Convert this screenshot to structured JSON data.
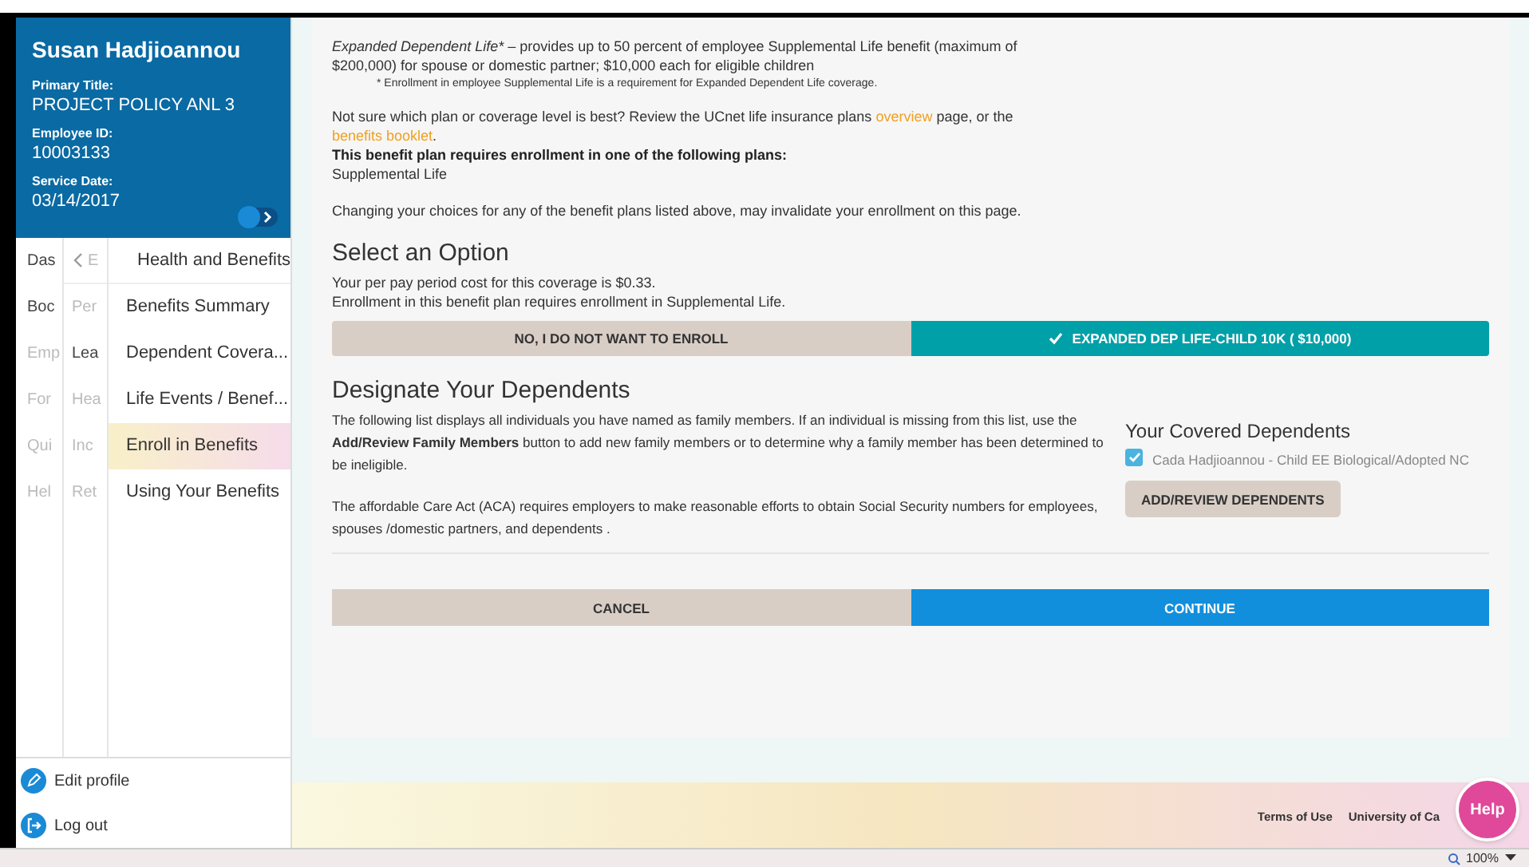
{
  "profile": {
    "name": "Susan Hadjioannou",
    "fields": [
      {
        "label": "Primary Title:",
        "value": "PROJECT POLICY ANL 3"
      },
      {
        "label": "Employee ID:",
        "value": "10003133"
      },
      {
        "label": "Service Date:",
        "value": "03/14/2017"
      }
    ]
  },
  "nav": {
    "column_1": [
      {
        "label": "Das",
        "dimmed": false
      },
      {
        "label": "Boc",
        "dimmed": false
      },
      {
        "label": "Emp",
        "dimmed": true
      },
      {
        "label": "For",
        "dimmed": true
      },
      {
        "label": "Qui",
        "dimmed": true
      },
      {
        "label": "Hel",
        "dimmed": true
      }
    ],
    "column_2": {
      "header": "E",
      "items": [
        {
          "label": "Per",
          "dimmed": true
        },
        {
          "label": "Lea",
          "dimmed": false
        },
        {
          "label": "Hea",
          "dimmed": true
        },
        {
          "label": "Inc",
          "dimmed": true
        },
        {
          "label": "Ret",
          "dimmed": true
        }
      ]
    },
    "column_3": {
      "header": "Health and Benefits",
      "items": [
        {
          "label": "Benefits Summary",
          "selected": false
        },
        {
          "label": "Dependent Covera...",
          "selected": false
        },
        {
          "label": "Life Events / Benef...",
          "selected": false
        },
        {
          "label": "Enroll in Benefits",
          "selected": true
        },
        {
          "label": "Using Your Benefits",
          "selected": false
        }
      ]
    }
  },
  "bottom_links": [
    {
      "label": "Edit profile",
      "kind": "edit"
    },
    {
      "label": "Log out",
      "kind": "logout"
    }
  ],
  "intro": {
    "term": "Expanded Dependent Life*",
    "text": "– provides up to 50 percent of employee Supplemental Life benefit (maximum of $200,000) for spouse or domestic partner; $10,000 each for eligible children",
    "footnote": "* Enrollment in employee Supplemental Life is a requirement for Expanded Dependent Life coverage.",
    "review": [
      {
        "kind": "text",
        "text": "Not sure which plan or coverage level is best? Review the UCnet life insurance plans "
      },
      {
        "kind": "link",
        "text": "overview"
      },
      {
        "kind": "text",
        "text": " page, or the "
      },
      {
        "kind": "link",
        "text": "benefits booklet"
      },
      {
        "kind": "text",
        "text": "."
      }
    ],
    "requirement": "This benefit plan requires enrollment in one of the following plans:",
    "plan": "Supplemental Life",
    "warning": "Changing your choices for any of the benefit plans listed above, may invalidate your enrollment on this page."
  },
  "select_option": {
    "title": "Select an Option",
    "lines": [
      "Your per pay period cost for this coverage is $0.33.",
      "Enrollment in this benefit plan requires enrollment in Supplemental Life."
    ],
    "options": [
      {
        "label": "NO, I DO NOT WANT TO ENROLL",
        "selected": false
      },
      {
        "label": "EXPANDED DEP LIFE-CHILD 10K ( $10,000)",
        "selected": true
      }
    ]
  },
  "dependents": {
    "title": "Designate Your Dependents",
    "paragraphs": [
      "The following list displays all individuals you have named as family members. If an individual is missing from this list, use the **Add/Review Family Members** button to add new family members or to determine why a family member has been determined to be ineligible.",
      "The affordable Care Act (ACA) requires employers to make reasonable efforts to obtain Social Security numbers for employees, spouses /domestic partners, and dependents ."
    ],
    "covered_title": "Your Covered Dependents",
    "covered": [
      {
        "label": "Cada Hadjioannou - Child EE Biological/Adopted NC",
        "checked": true
      }
    ],
    "review_button": "ADD/REVIEW DEPENDENTS"
  },
  "actions": [
    {
      "label": "CANCEL",
      "primary": false
    },
    {
      "label": "CONTINUE",
      "primary": true
    }
  ],
  "footer": {
    "links": [
      "Terms of Use",
      "University of Ca"
    ],
    "help": "Help"
  },
  "status_bar": {
    "zoom": "100%"
  }
}
